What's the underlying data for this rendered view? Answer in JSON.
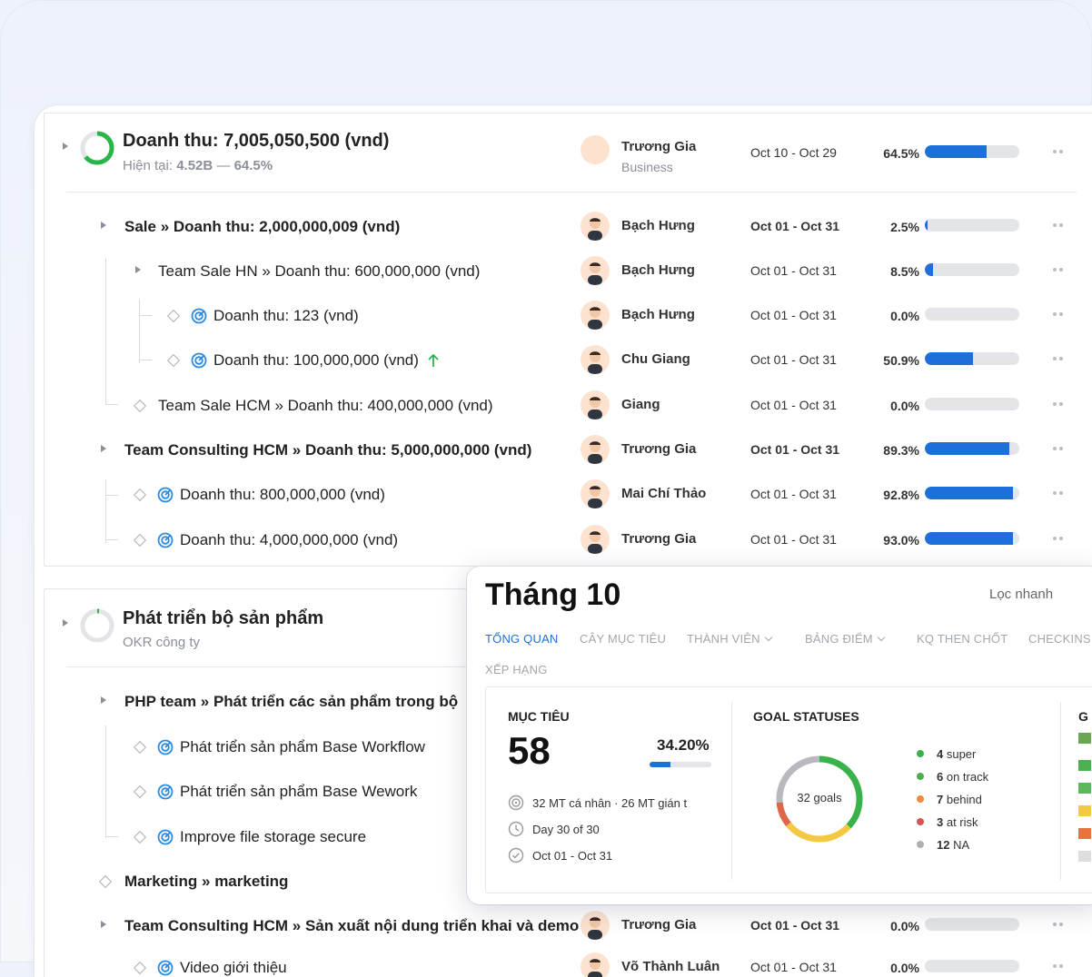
{
  "objectives": [
    {
      "title": "Doanh thu: 7,005,050,500 (vnd)",
      "subtitle_prefix": "Hiện tại: ",
      "subtitle_current": "4.52B",
      "subtitle_sep": " — ",
      "subtitle_pct": "64.5%",
      "ring_progress": 0.645,
      "owner": "Trương Gia",
      "owner_team": "Business",
      "dates": "Oct 10 - Oct 29",
      "pct": "64.5%",
      "progress": 0.645,
      "children": [
        {
          "title": "Sale » Doanh thu: 2,000,000,009 (vnd)",
          "owner": "Bạch Hưng",
          "dates": "Oct 01 - Oct 31",
          "pct": "2.5%",
          "progress": 0.025
        },
        {
          "title": "Team Sale HN » Doanh thu: 600,000,000 (vnd)",
          "owner": "Bạch Hưng",
          "dates": "Oct 01 - Oct 31",
          "pct": "8.5%",
          "progress": 0.085
        },
        {
          "title": "Doanh thu: 123 (vnd)",
          "owner": "Bạch Hưng",
          "dates": "Oct 01 - Oct 31",
          "pct": "0.0%",
          "progress": 0
        },
        {
          "title": "Doanh thu: 100,000,000 (vnd)",
          "owner": "Chu Giang",
          "dates": "Oct 01 - Oct 31",
          "pct": "50.9%",
          "progress": 0.509
        },
        {
          "title": "Team Sale HCM » Doanh thu: 400,000,000 (vnd)",
          "owner": "Giang",
          "dates": "Oct 01 - Oct 31",
          "pct": "0.0%",
          "progress": 0
        },
        {
          "title": "Team Consulting HCM » Doanh thu: 5,000,000,000 (vnd)",
          "owner": "Trương Gia",
          "dates": "Oct 01 - Oct 31",
          "pct": "89.3%",
          "progress": 0.893
        },
        {
          "title": "Doanh thu: 800,000,000 (vnd)",
          "owner": "Mai Chí Thảo",
          "dates": "Oct 01 - Oct 31",
          "pct": "92.8%",
          "progress": 0.928
        },
        {
          "title": "Doanh thu: 4,000,000,000 (vnd)",
          "owner": "Trương Gia",
          "dates": "Oct 01 - Oct 31",
          "pct": "93.0%",
          "progress": 0.93
        }
      ]
    },
    {
      "title": "Phát triển bộ sản phẩm",
      "subtitle": "OKR công ty",
      "ring_progress": 0.0,
      "children": [
        {
          "title": "PHP team » Phát triển các sản phẩm trong bộ"
        },
        {
          "title": "Phát triển sản phẩm Base Workflow"
        },
        {
          "title": "Phát triển sản phẩm Base Wework"
        },
        {
          "title": "Improve file storage secure"
        },
        {
          "title": "Marketing » marketing"
        },
        {
          "title": "Team Consulting HCM » Sản xuất nội dung triển khai và demo",
          "owner": "Trương Gia",
          "dates": "Oct 01 - Oct 31",
          "pct": "0.0%",
          "progress": 0
        },
        {
          "title": "Video giới thiệu",
          "owner": "Võ Thành Luân",
          "dates": "Oct 01 - Oct 31",
          "pct": "0.0%",
          "progress": 0
        }
      ]
    }
  ],
  "overlay": {
    "title": "Tháng 10",
    "quick_filter": "Lọc nhanh",
    "tabs": [
      "TỔNG QUAN",
      "CÂY MỤC TIÊU",
      "THÀNH VIÊN",
      "BẢNG ĐIỂM",
      "KQ THEN CHỐT",
      "CHECKINS",
      "XẾP HẠNG"
    ],
    "objectives_panel": {
      "heading": "MỤC TIÊU",
      "count": "58",
      "pct": "34.20%",
      "progress": 0.342,
      "meta": [
        "32 MT cá nhân · 26 MT gián t",
        "Day 30 of 30",
        "Oct 01 - Oct 31"
      ]
    },
    "statuses_panel": {
      "heading": "GOAL STATUSES",
      "center_label": "32 goals",
      "legend": [
        {
          "count": "4",
          "label": " super",
          "color": "#3ab24a",
          "value": 4
        },
        {
          "count": "6",
          "label": " on track",
          "color": "#4caf50",
          "value": 6
        },
        {
          "count": "7",
          "label": " behind",
          "color": "#f08a3c",
          "value": 7
        },
        {
          "count": "3",
          "label": " at risk",
          "color": "#d9534f",
          "value": 3
        },
        {
          "count": "12",
          "label": " NA",
          "color": "#b0b0b0",
          "value": 12
        }
      ],
      "donut_colors": {
        "green": "#3ab24a",
        "yellow": "#f5c842",
        "red": "#e0664a",
        "grey": "#b7b9be"
      }
    },
    "cut_panel_heading": "G"
  }
}
